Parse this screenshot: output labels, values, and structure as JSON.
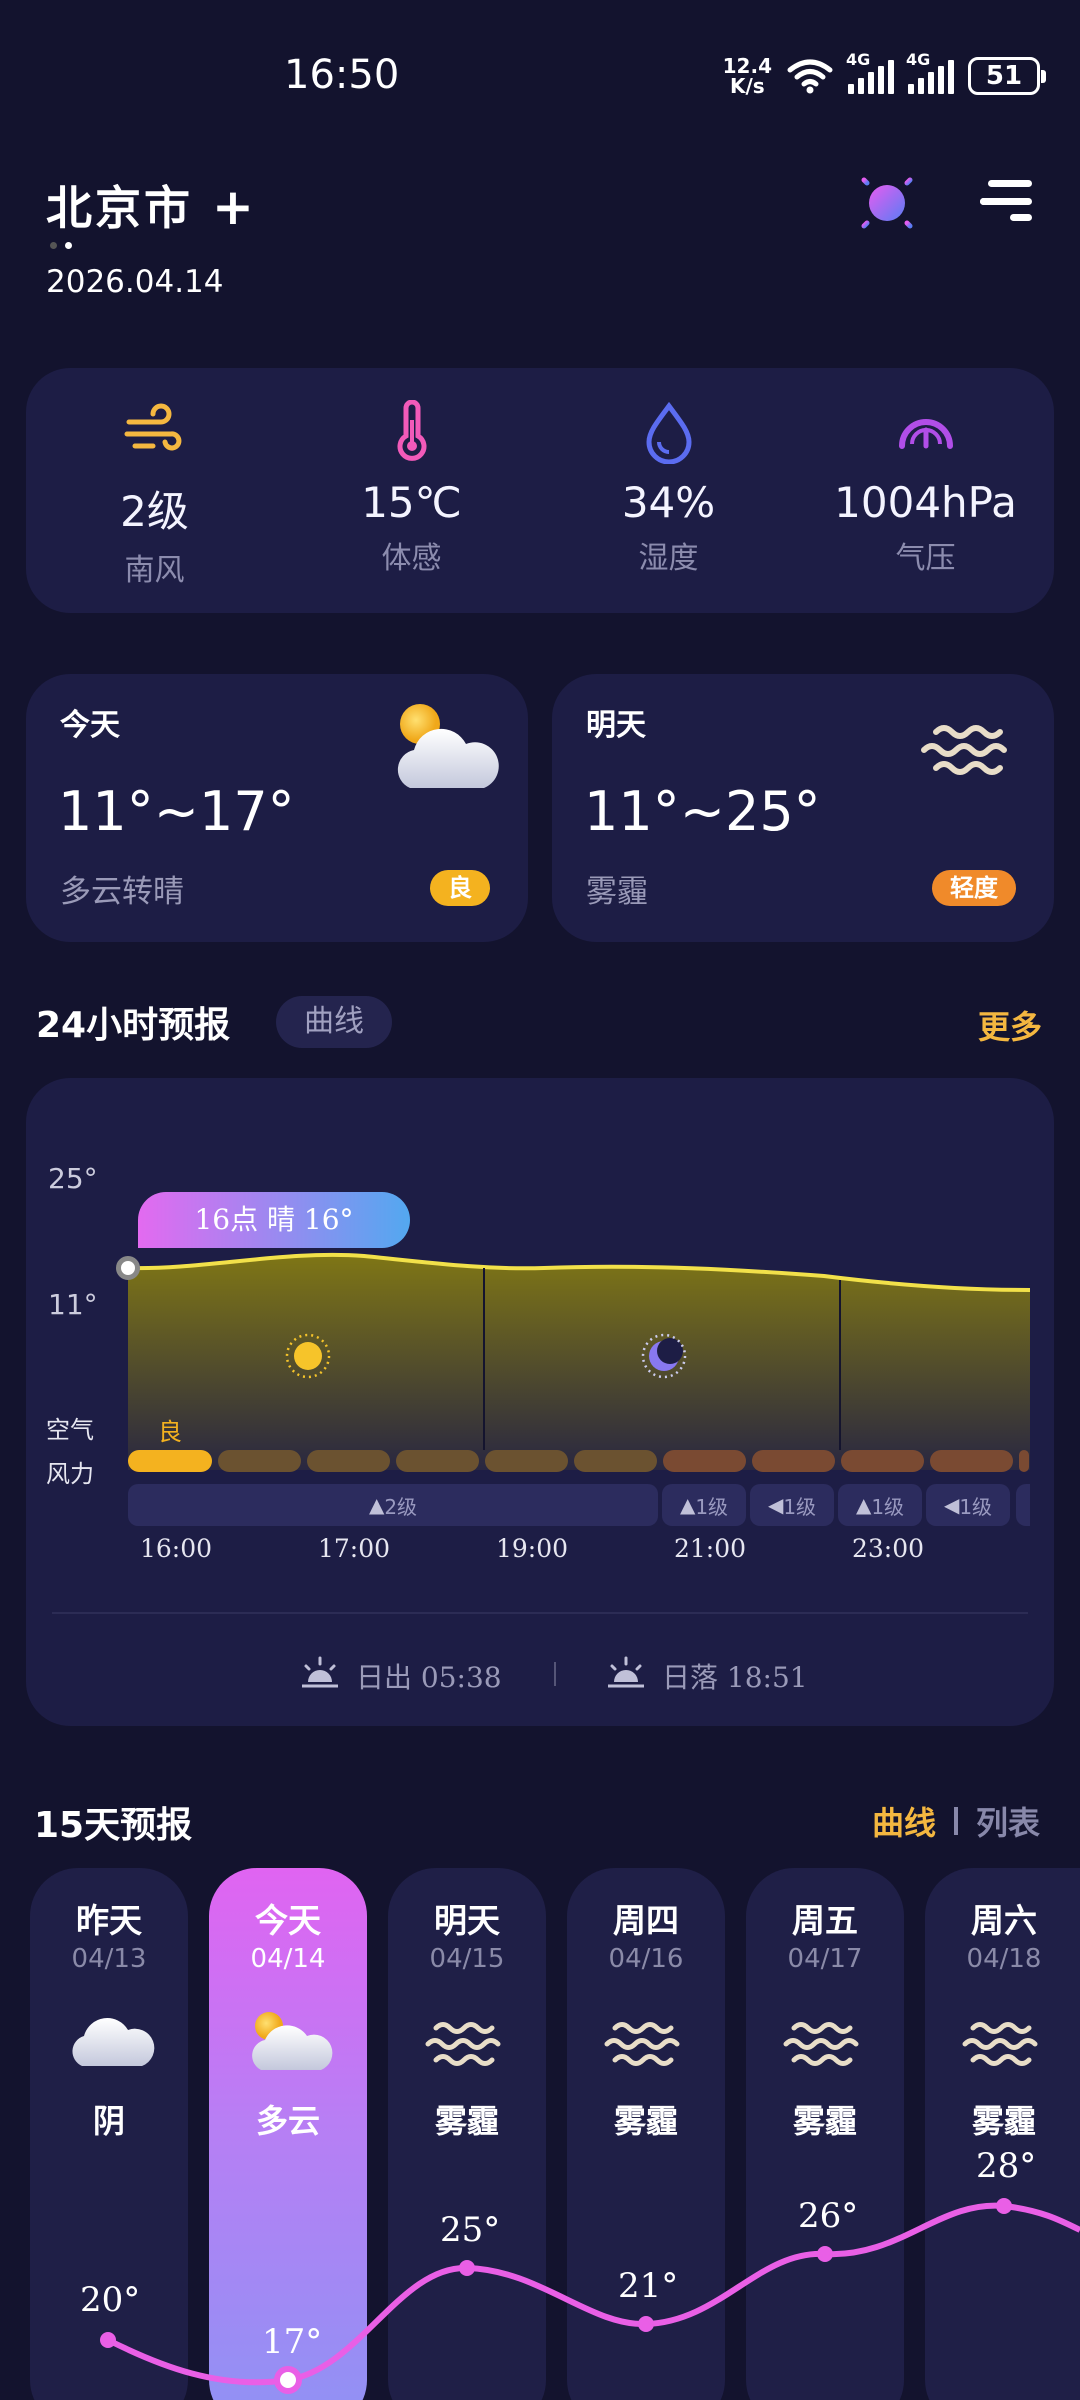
{
  "status": {
    "time": "16:50",
    "netspeed_top": "12.4",
    "netspeed_bottom": "K/s",
    "net1": "4G",
    "net2": "4G",
    "battery": "51"
  },
  "header": {
    "city": "北京市",
    "date": "2026.04.14"
  },
  "stats": [
    {
      "icon": "wind-icon",
      "value": "2级",
      "label": "南风",
      "color": "#f4b740"
    },
    {
      "icon": "thermometer-icon",
      "value": "15℃",
      "label": "体感",
      "color": "#f25ab9"
    },
    {
      "icon": "water-drop-icon",
      "value": "34%",
      "label": "湿度",
      "color": "#5b6cf0"
    },
    {
      "icon": "pressure-gauge-icon",
      "value": "1004hPa",
      "label": "气压",
      "color": "#b14ee8"
    }
  ],
  "today": {
    "title": "今天",
    "temp": "11°~17°",
    "desc": "多云转晴",
    "aqi": "良",
    "aqi_color": "#f4b21f",
    "icon": "partly-cloudy-icon"
  },
  "tomorrow": {
    "title": "明天",
    "temp": "11°~25°",
    "desc": "雾霾",
    "aqi": "轻度",
    "aqi_color": "#f08a2a",
    "icon": "haze-icon"
  },
  "hourly": {
    "title": "24小时预报",
    "mode": "曲线",
    "more": "更多",
    "y_top": "25°",
    "y_bottom": "11°",
    "tooltip": "16点 晴 16°",
    "row_air": "空气",
    "row_wind": "风力",
    "aqi_first": "良",
    "wind": [
      "2级",
      "1级",
      "1级",
      "1级",
      "1级"
    ],
    "times": [
      "16:00",
      "17:00",
      "19:00",
      "21:00",
      "23:00"
    ],
    "sunrise_label": "日出 05:38",
    "sunset_label": "日落 18:51"
  },
  "daily": {
    "title": "15天预报",
    "tab_curve": "曲线",
    "tab_list": "列表",
    "days": [
      {
        "name": "昨天",
        "date": "04/13",
        "desc": "阴",
        "high": "20°",
        "icon": "cloud-icon"
      },
      {
        "name": "今天",
        "date": "04/14",
        "desc": "多云",
        "high": "17°",
        "icon": "partly-cloudy-icon"
      },
      {
        "name": "明天",
        "date": "04/15",
        "desc": "雾霾",
        "high": "25°",
        "icon": "haze-icon"
      },
      {
        "name": "周四",
        "date": "04/16",
        "desc": "雾霾",
        "high": "21°",
        "icon": "haze-icon"
      },
      {
        "name": "周五",
        "date": "04/17",
        "desc": "雾霾",
        "high": "26°",
        "icon": "haze-icon"
      },
      {
        "name": "周六",
        "date": "04/18",
        "desc": "雾霾",
        "high": "28°",
        "icon": "haze-icon"
      }
    ]
  }
}
